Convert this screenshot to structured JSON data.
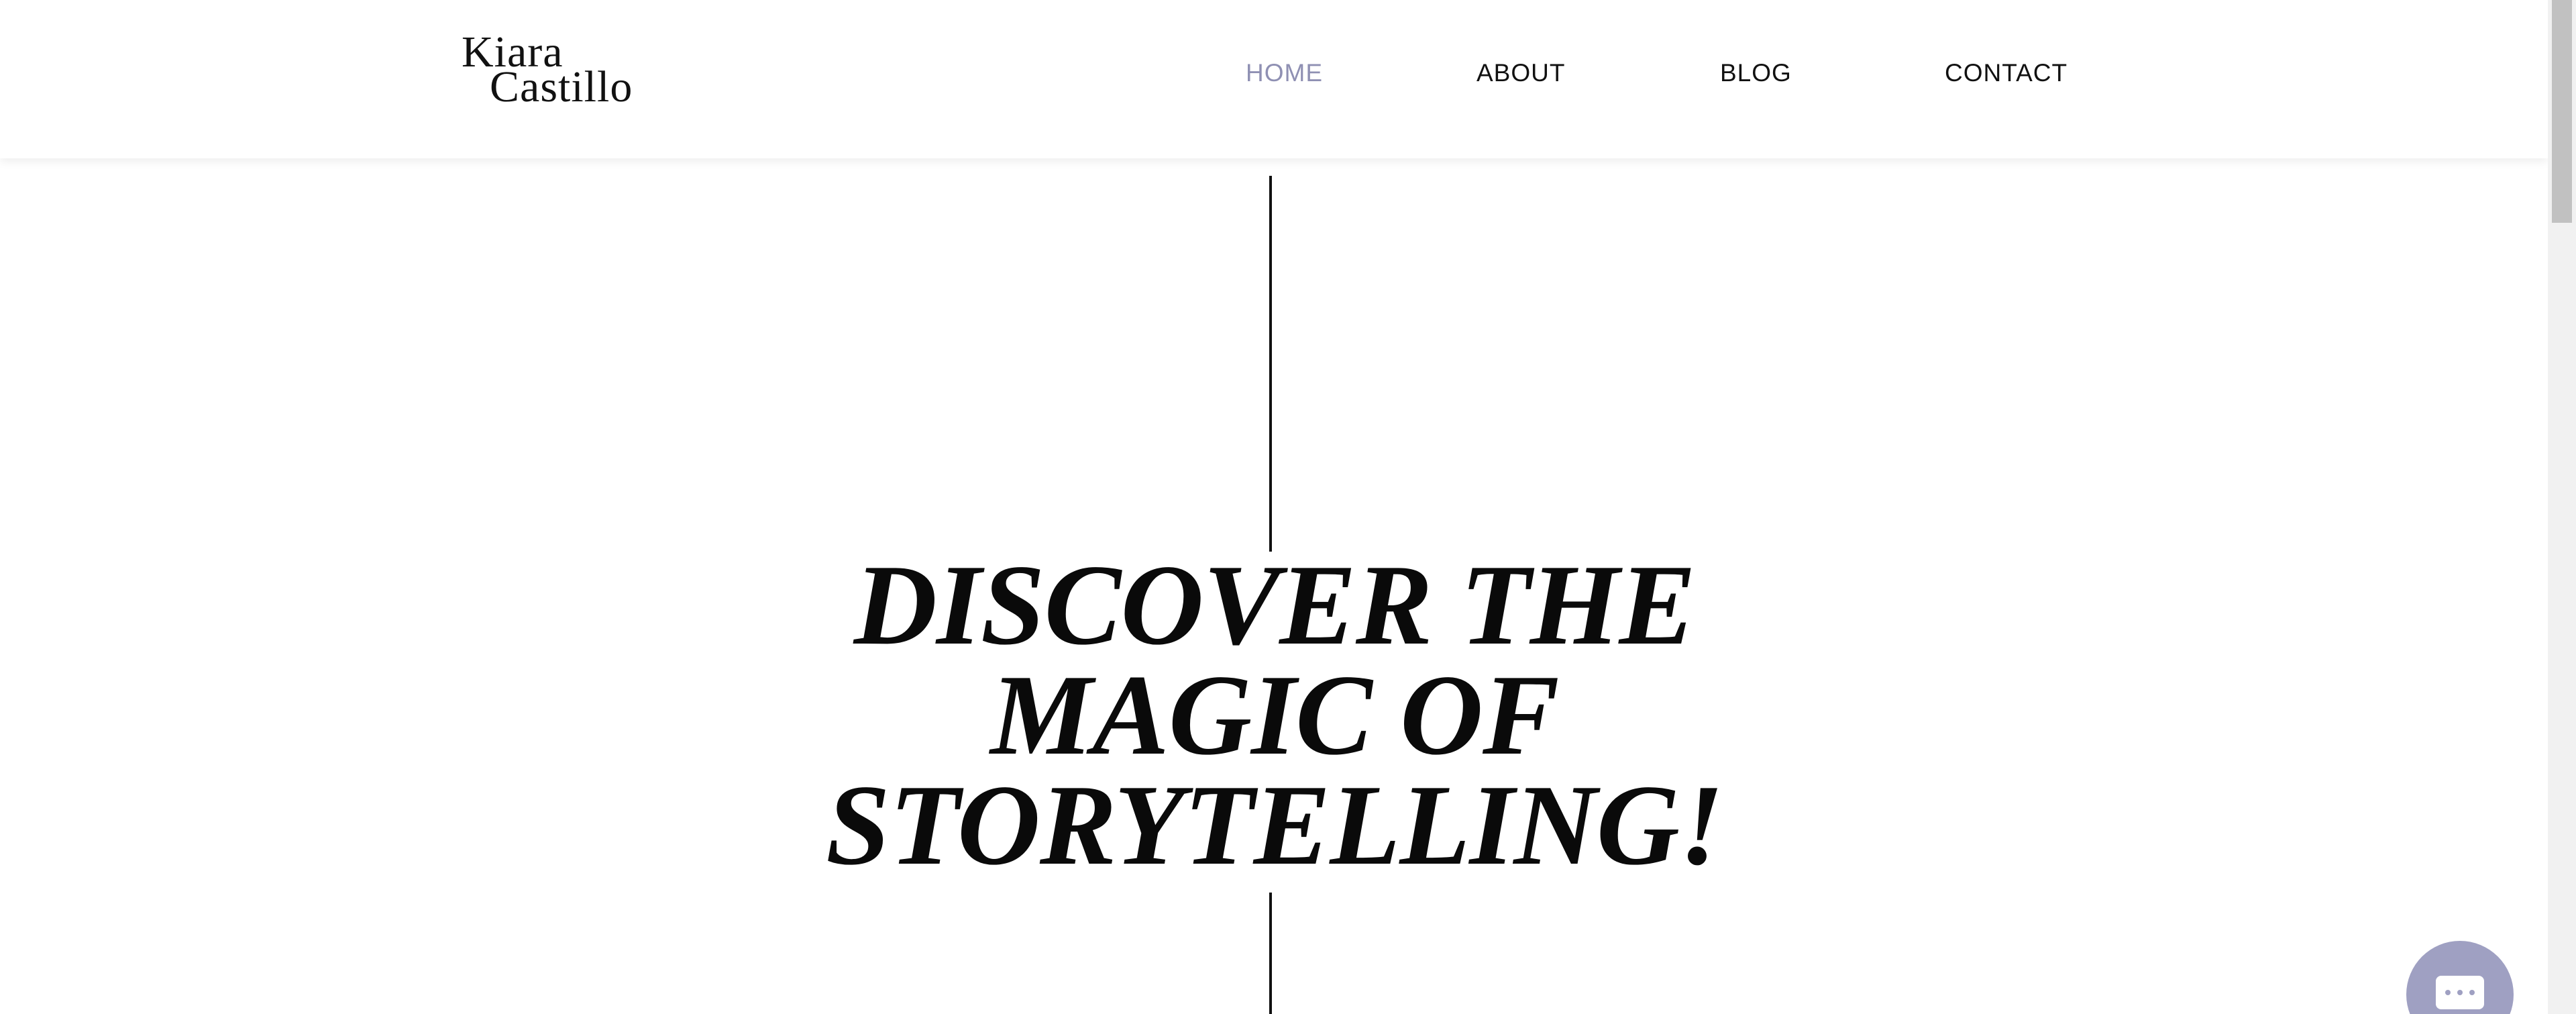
{
  "header": {
    "logo": {
      "line1": "Kiara",
      "line2": "Castillo"
    },
    "nav": [
      {
        "label": "HOME",
        "active": true
      },
      {
        "label": "ABOUT",
        "active": false
      },
      {
        "label": "BLOG",
        "active": false
      },
      {
        "label": "CONTACT",
        "active": false
      }
    ]
  },
  "hero": {
    "lines": [
      "DISCOVER THE",
      "MAGIC OF",
      "STORYTELLING!"
    ]
  },
  "chat": {
    "icon": "chat-bubble-icon"
  },
  "colors": {
    "accent": "#8f90b3",
    "chat_bg": "#9fa0c2",
    "text": "#111111",
    "background": "#ffffff"
  }
}
